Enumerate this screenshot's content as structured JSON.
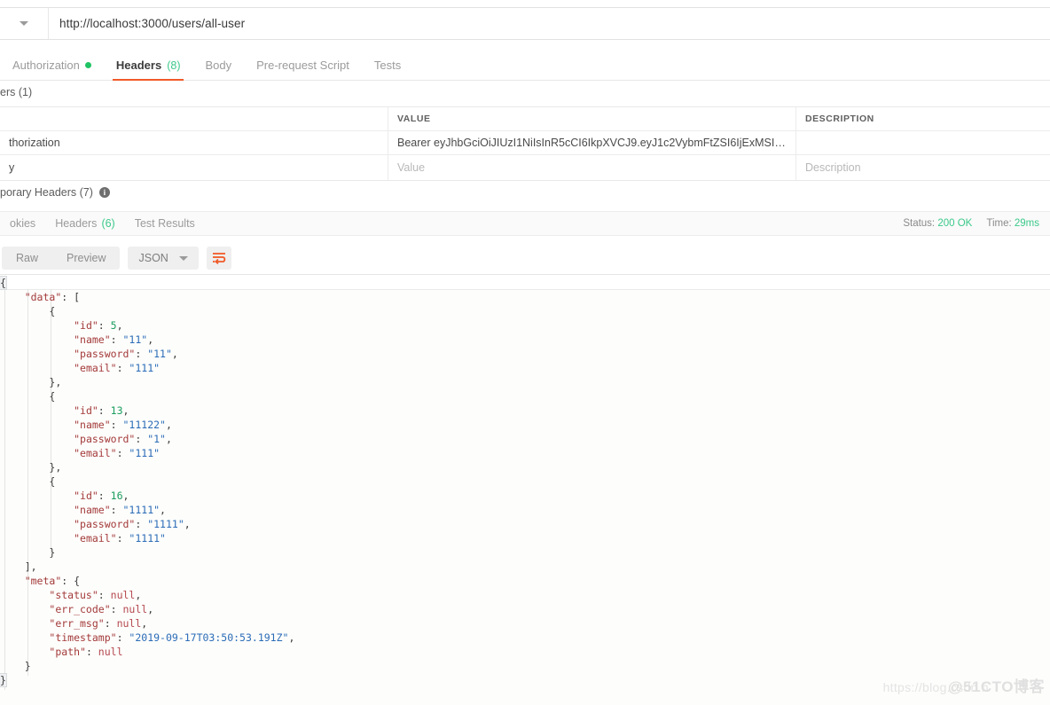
{
  "url_bar": {
    "method_caret": "chevron-down-icon",
    "url": "http://localhost:3000/users/all-user"
  },
  "request_tabs": [
    {
      "label": "Authorization",
      "indicator": "green-dot",
      "active": false
    },
    {
      "label": "Headers",
      "count": "(8)",
      "active": true
    },
    {
      "label": "Body",
      "active": false
    },
    {
      "label": "Pre-request Script",
      "active": false
    },
    {
      "label": "Tests",
      "active": false
    }
  ],
  "headers_section": {
    "section_label": "ers (1)",
    "columns": {
      "key": "",
      "value": "VALUE",
      "description": "DESCRIPTION"
    },
    "rows": [
      {
        "key": "thorization",
        "value": "Bearer eyJhbGciOiJIUzI1NiIsInR5cCI6IkpXVCJ9.eyJ1c2VybmFtZSI6IjExMSIsImVtYWlsIjoiMT…",
        "description": ""
      },
      {
        "key": "y",
        "value_placeholder": "Value",
        "description_placeholder": "Description"
      }
    ],
    "temporary_headers": "porary Headers (7)",
    "info_icon": "info-icon"
  },
  "response_tabs": [
    {
      "label": "okies"
    },
    {
      "label": "Headers",
      "count": "(6)"
    },
    {
      "label": "Test Results"
    }
  ],
  "response_status": {
    "status_label": "Status:",
    "status_value": "200 OK",
    "time_label": "Time:",
    "time_value": "29ms"
  },
  "body_toolbar": {
    "raw_label": "Raw",
    "preview_label": "Preview",
    "format_label": "JSON",
    "format_caret": "chevron-down-icon",
    "wrap_icon": "word-wrap-icon"
  },
  "response_body": {
    "data": [
      {
        "id": 5,
        "name": "11",
        "password": "11",
        "email": "111"
      },
      {
        "id": 13,
        "name": "11122",
        "password": "1",
        "email": "111"
      },
      {
        "id": 16,
        "name": "1111",
        "password": "1111",
        "email": "1111"
      }
    ],
    "meta": {
      "status": null,
      "err_code": null,
      "err_msg": null,
      "timestamp": "2019-09-17T03:50:53.191Z",
      "path": null
    }
  },
  "watermark": {
    "line1": "https://blog.csdn.n",
    "line2": "@51CTO博客"
  },
  "colors": {
    "accent_orange": "#f15a29",
    "status_green": "#3cc98a",
    "json_key": "#a33a3a",
    "json_string": "#2b6cb8",
    "json_number": "#1a9e5e",
    "json_null": "#b5484f"
  }
}
